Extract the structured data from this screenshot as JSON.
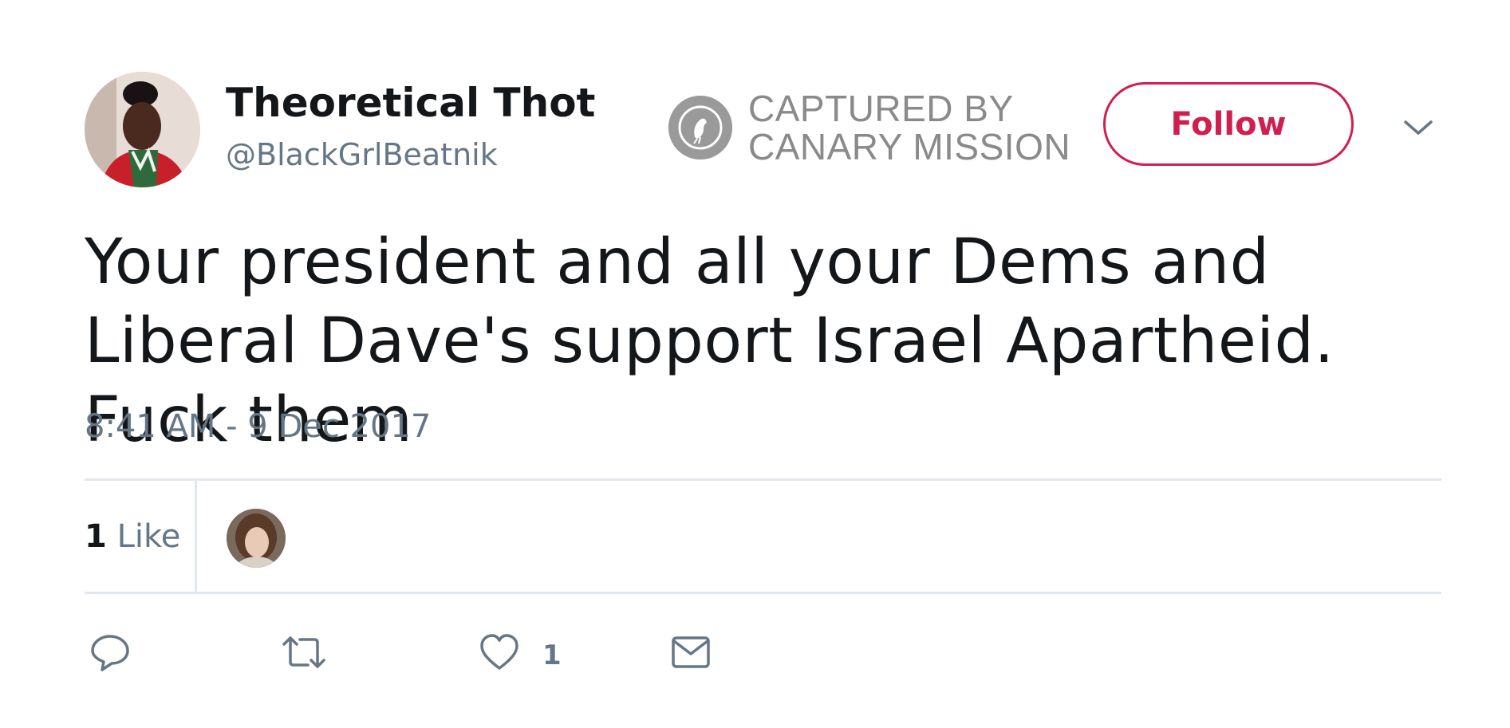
{
  "user": {
    "display_name": "Theoretical Thot",
    "handle": "@BlackGrlBeatnik"
  },
  "watermark": {
    "line1": "CAPTURED BY",
    "line2": "CANARY MISSION"
  },
  "follow_button": {
    "label": "Follow"
  },
  "tweet": {
    "text": "Your president and all your Dems and Liberal Dave's support Israel Apartheid. Fuck them",
    "timestamp": "8:41 AM - 9 Dec 2017"
  },
  "stats": {
    "like_count": "1",
    "like_label": "Like"
  },
  "actions": {
    "like_count": "1"
  },
  "colors": {
    "follow_accent": "#d01f4e",
    "secondary_text": "#657786",
    "divider": "#e1e8ed",
    "watermark": "#8a8a8a"
  },
  "icons": [
    "chevron-down-icon",
    "reply-icon",
    "retweet-icon",
    "heart-icon",
    "envelope-icon",
    "canary-bird-icon"
  ]
}
